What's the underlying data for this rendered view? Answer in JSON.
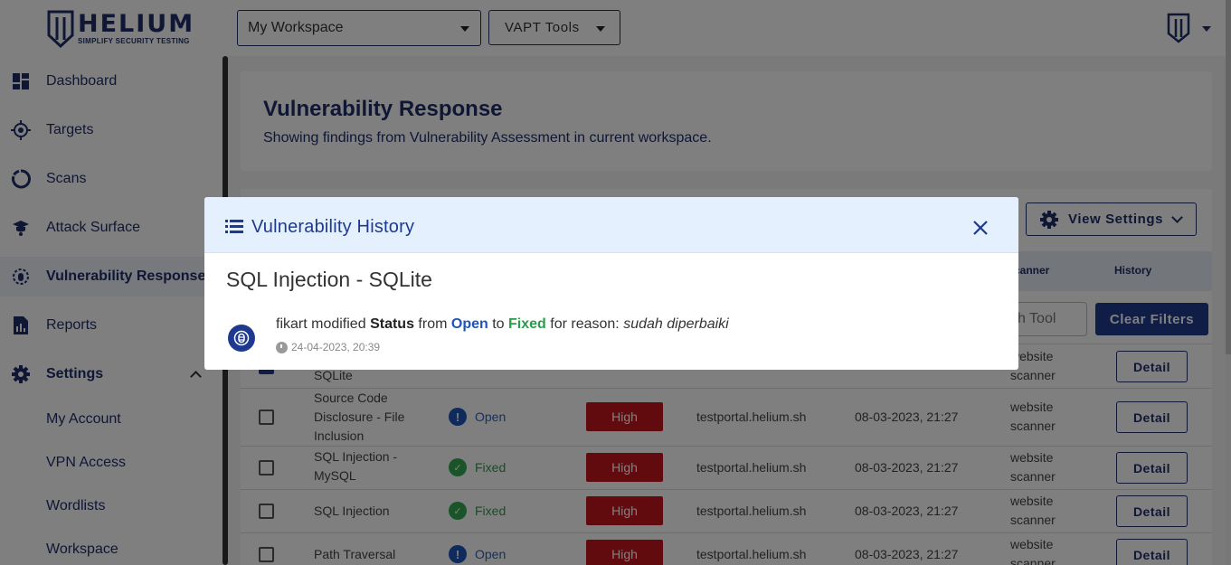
{
  "app": {
    "logo_title": "HELIUM",
    "logo_subtitle": "SIMPLIFY SECURITY TESTING"
  },
  "topbar": {
    "workspace_selected": "My Workspace",
    "tools_label": "VAPT Tools"
  },
  "sidebar": {
    "items": [
      {
        "label": "Dashboard",
        "icon": "dashboard-icon"
      },
      {
        "label": "Targets",
        "icon": "target-icon"
      },
      {
        "label": "Scans",
        "icon": "scan-icon"
      },
      {
        "label": "Attack Surface",
        "icon": "attack-surface-icon"
      },
      {
        "label": "Vulnerability Response",
        "icon": "bug-icon",
        "active": true
      },
      {
        "label": "Reports",
        "icon": "report-icon"
      },
      {
        "label": "Settings",
        "icon": "gear-icon",
        "expanded": true
      }
    ],
    "settings_sub": [
      "My Account",
      "VPN Access",
      "Wordlists",
      "Workspace"
    ]
  },
  "page": {
    "title": "Vulnerability Response",
    "subtitle": "Showing findings from Vulnerability Assessment in current workspace."
  },
  "toolbar": {
    "view_settings": "View Settings",
    "clear_filters": "Clear Filters",
    "search_tool_placeholder": "ch Tool"
  },
  "table": {
    "headers": {
      "scanner": "canner",
      "history": "History"
    },
    "detail_label": "Detail",
    "rows": [
      {
        "name": "SQLite",
        "status": "",
        "severity": "",
        "target": "",
        "date": "",
        "scanner": "website scanner",
        "checked": true
      },
      {
        "name": "Source Code Disclosure - File Inclusion",
        "status": "Open",
        "severity": "High",
        "target": "testportal.helium.sh",
        "date": "08-03-2023, 21:27",
        "scanner": "website scanner"
      },
      {
        "name": "SQL Injection - MySQL",
        "status": "Fixed",
        "severity": "High",
        "target": "testportal.helium.sh",
        "date": "08-03-2023, 21:27",
        "scanner": "website scanner"
      },
      {
        "name": "SQL Injection",
        "status": "Fixed",
        "severity": "High",
        "target": "testportal.helium.sh",
        "date": "08-03-2023, 21:27",
        "scanner": "website scanner"
      },
      {
        "name": "Path Traversal",
        "status": "Open",
        "severity": "High",
        "target": "testportal.helium.sh",
        "date": "08-03-2023, 21:27",
        "scanner": "website scanner"
      }
    ]
  },
  "modal": {
    "title": "Vulnerability History",
    "vuln_name": "SQL Injection - SQLite",
    "history": [
      {
        "user": "fikart",
        "action": "modified",
        "field": "Status",
        "from_word": "from",
        "from": "Open",
        "to_word": "to",
        "to": "Fixed",
        "reason_prefix": "for reason:",
        "reason": "sudah diperbaiki",
        "timestamp": "24-04-2023, 20:39"
      }
    ]
  },
  "colors": {
    "brand": "#1e2f6b",
    "accent": "#1e3a8f",
    "severity_high": "#c4161c",
    "status_open": "#1f54b8",
    "status_fixed": "#34a853"
  }
}
